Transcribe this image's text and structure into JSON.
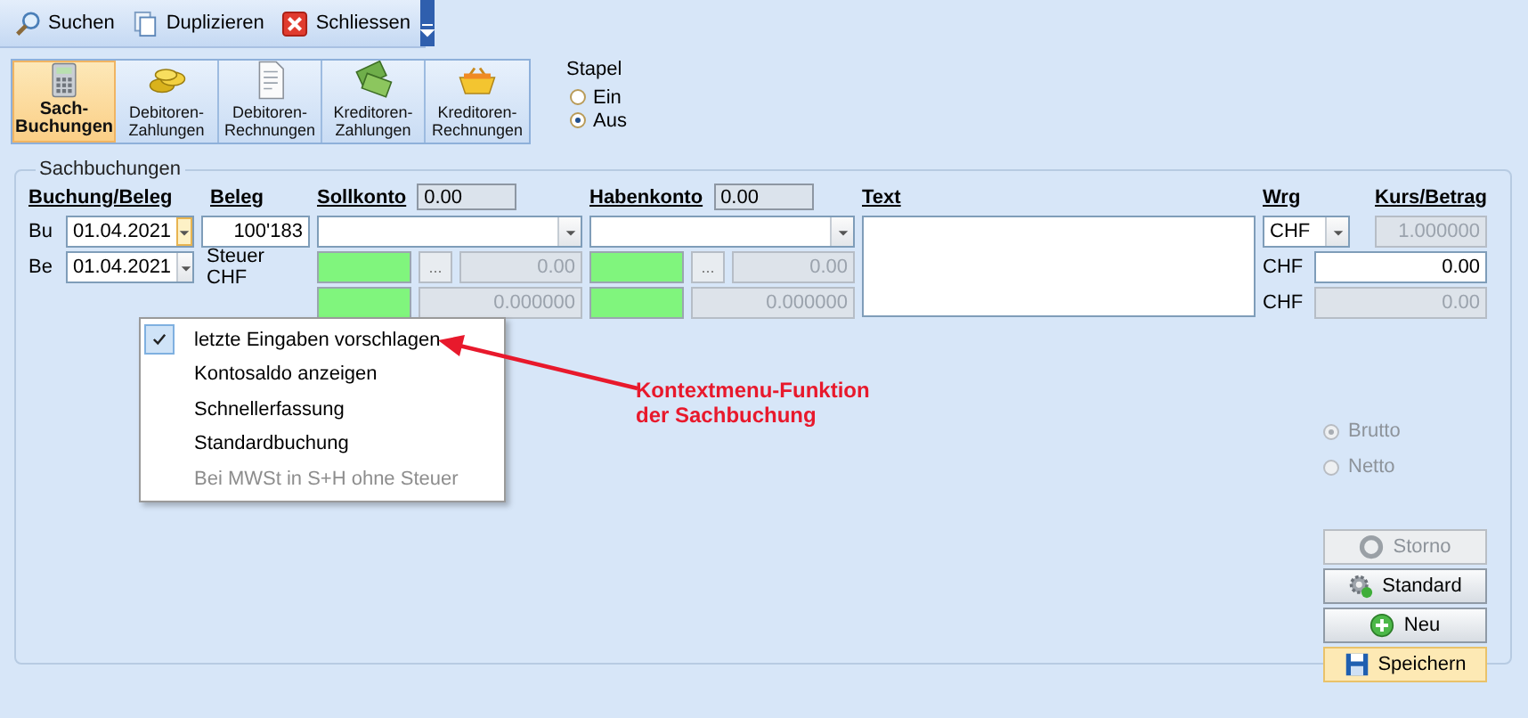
{
  "toolbar": [
    {
      "label": "Suchen",
      "kind": "search"
    },
    {
      "label": "Duplizieren",
      "kind": "copy"
    },
    {
      "label": "Schliessen",
      "kind": "close"
    }
  ],
  "modules": [
    {
      "label": "Sach-\nBuchungen",
      "kind": "calculator",
      "selected": true
    },
    {
      "label": "Debitoren-\nZahlungen",
      "kind": "coins",
      "selected": false
    },
    {
      "label": "Debitoren-\nRechnungen",
      "kind": "document",
      "selected": false
    },
    {
      "label": "Kreditoren-\nZahlungen",
      "kind": "banknotes",
      "selected": false
    },
    {
      "label": "Kreditoren-\nRechnungen",
      "kind": "basket",
      "selected": false
    }
  ],
  "stapel": {
    "label": "Stapel",
    "options": [
      {
        "label": "Ein",
        "selected": false
      },
      {
        "label": "Aus",
        "selected": true
      }
    ]
  },
  "form": {
    "title": "Sachbuchungen",
    "headers": {
      "buchung": "Buchung/Beleg",
      "beleg": "Beleg",
      "sollkonto": "Sollkonto",
      "sollkonto_saldo": "0.00",
      "habenkonto": "Habenkonto",
      "habenkonto_saldo": "0.00",
      "text": "Text",
      "wrg": "Wrg",
      "kurs": "Kurs/Betrag"
    },
    "bu": {
      "label": "Bu",
      "date": "01.04.2021",
      "focused": true,
      "beleg": "100'183"
    },
    "be": {
      "label": "Be",
      "date": "01.04.2021",
      "focused": false,
      "steuer_label": "Steuer CHF"
    },
    "accounts": [
      {
        "button": "...",
        "betrag": "0.00",
        "kurs": "0.000000"
      },
      {
        "button": "...",
        "betrag": "0.00",
        "kurs": "0.000000"
      }
    ],
    "currency": {
      "value": "CHF",
      "kurs": "1.000000",
      "rows": [
        {
          "label": "CHF",
          "value": "0.00",
          "disabled": false
        },
        {
          "label": "CHF",
          "value": "0.00",
          "disabled": true
        }
      ]
    },
    "mode": [
      {
        "label": "Brutto",
        "selected": true,
        "disabled": true
      },
      {
        "label": "Netto",
        "selected": false,
        "disabled": true
      }
    ],
    "buttons": [
      {
        "label": "Storno",
        "kind": "storno",
        "disabled": true,
        "highlighted": false
      },
      {
        "label": "Standard",
        "kind": "gear",
        "disabled": false,
        "highlighted": false
      },
      {
        "label": "Neu",
        "kind": "plus",
        "disabled": false,
        "highlighted": false
      },
      {
        "label": "Speichern",
        "kind": "save",
        "disabled": false,
        "highlighted": true
      }
    ]
  },
  "context_menu": {
    "items": [
      {
        "label": "letzte Eingaben vorschlagen",
        "checked": true,
        "disabled": false
      },
      {
        "label": "Kontosaldo anzeigen",
        "checked": false,
        "disabled": false
      },
      {
        "label": "Schnellerfassung",
        "checked": false,
        "disabled": false
      },
      {
        "label": "Standardbuchung",
        "checked": false,
        "disabled": false
      },
      {
        "label": "Bei MWSt in S+H ohne Steuer",
        "checked": false,
        "disabled": true
      }
    ]
  },
  "annotation": {
    "text": "Kontextmenu-Funktion\nder Sachbuchung"
  }
}
